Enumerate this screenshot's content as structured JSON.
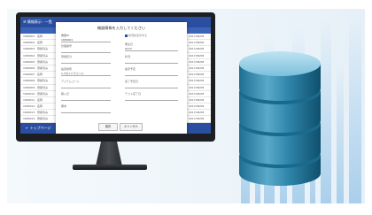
{
  "app": {
    "header_title": "情報表示 - 一覧",
    "columns": [
      "番号",
      "コード",
      "種別"
    ],
    "rows": [
      [
        "1680001",
        "名称"
      ],
      [
        "1680002",
        "名称"
      ],
      [
        "1680003",
        "登録済み"
      ],
      [
        "1680004",
        "登録済み"
      ],
      [
        "1680005",
        "登録済み"
      ],
      [
        "1680006",
        "登録済み"
      ],
      [
        "1680007",
        "名称"
      ],
      [
        "1680008",
        "登録済み"
      ],
      [
        "1680009",
        "登録済み"
      ],
      [
        "1680010",
        "登録済み"
      ],
      [
        "1680011",
        "名称"
      ],
      [
        "1680012",
        "名称"
      ],
      [
        "1680013",
        "登録済み"
      ],
      [
        "1680014",
        "登録済み"
      ],
      [
        "1680015",
        "名称"
      ],
      [
        "1680016",
        "名称"
      ]
    ],
    "right_col_values": [
      "2017/08/08",
      "2017/08/08",
      "2017/08/08",
      "2017/08/08",
      "2017/08/08",
      "2017/08/08",
      "2017/08/08",
      "2017/08/08",
      "2017/08/08",
      "2017/08/08",
      "2017/08/08",
      "2017/08/08",
      "2017/08/08",
      "2017/08/08"
    ],
    "footer_label": "← トップページ"
  },
  "modal": {
    "title": "機器情報を入力してください",
    "fields": {
      "f1_label": "機器ID",
      "f1_value": "1680001",
      "f2_label": "管理番号",
      "f2_value": "",
      "f3_label": "登録区分",
      "f3_value": "",
      "f4_label": "設置場所",
      "f4_value": "1-3ガイドラインド",
      "f5_label": "アイテムコード",
      "f5_value": "",
      "f6_label": "購入日",
      "f6_value": "",
      "f7_label": "備考",
      "f7_value": "",
      "r1_check": "状況を表示する",
      "r2_label": "発注日",
      "r2_value": "0123",
      "r3_label": "状況",
      "r3_value": "",
      "r4_label": "着手予定",
      "r4_value": "",
      "r5_label": "完了予定日",
      "r5_value": "",
      "r6_label": "テスト完了日",
      "r6_value": ""
    },
    "ok_label": "保存",
    "cancel_label": "キャンセル"
  }
}
